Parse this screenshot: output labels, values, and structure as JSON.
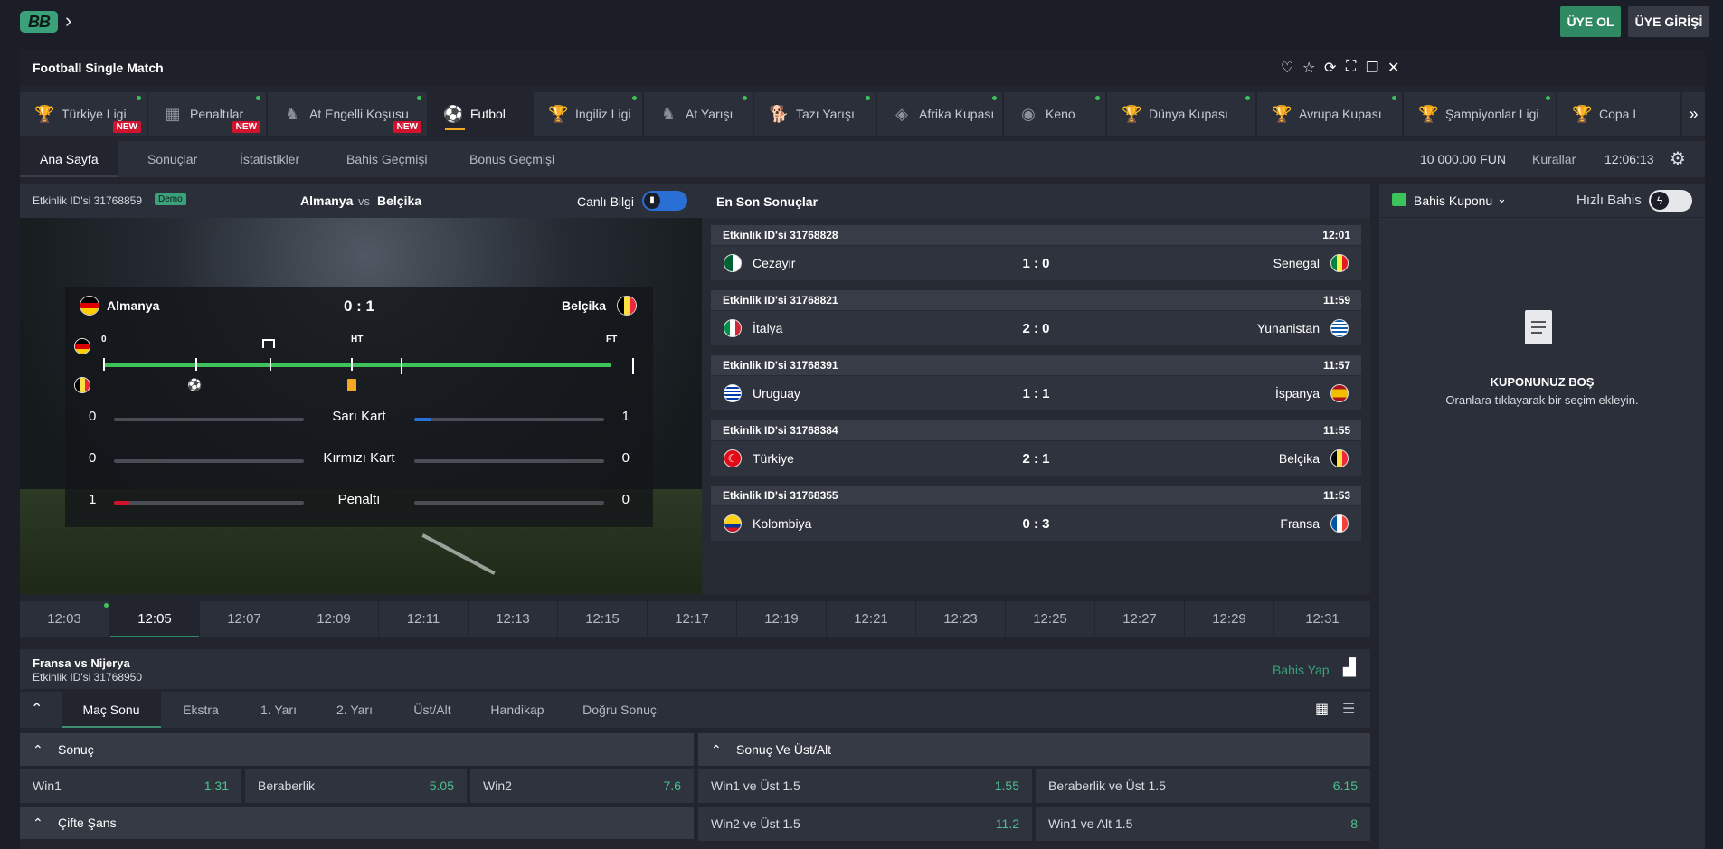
{
  "header": {
    "logo_text": "BB",
    "register": "ÜYE OL",
    "login": "ÜYE GİRİŞİ"
  },
  "window": {
    "title": "Football Single Match"
  },
  "game_tabs": [
    {
      "label": "Türkiye Ligi",
      "badge": "NEW",
      "icon": "trophy-icon"
    },
    {
      "label": "Penaltılar",
      "badge": "NEW",
      "icon": "goal-net-icon"
    },
    {
      "label": "At Engelli Koşusu",
      "badge": "NEW",
      "icon": "horse-jump-icon"
    },
    {
      "label": "Futbol",
      "badge": "",
      "icon": "football-icon"
    },
    {
      "label": "İngiliz Ligi",
      "badge": "",
      "icon": "trophy-icon"
    },
    {
      "label": "At Yarışı",
      "badge": "",
      "icon": "horse-icon"
    },
    {
      "label": "Tazı Yarışı",
      "badge": "",
      "icon": "greyhound-icon"
    },
    {
      "label": "Afrika Kupası",
      "badge": "",
      "icon": "africa-icon"
    },
    {
      "label": "Keno",
      "badge": "",
      "icon": "keno-icon"
    },
    {
      "label": "Dünya Kupası",
      "badge": "",
      "icon": "world-cup-icon"
    },
    {
      "label": "Avrupa Kupası",
      "badge": "",
      "icon": "euro-cup-icon"
    },
    {
      "label": "Şampiyonlar Ligi",
      "badge": "",
      "icon": "champions-cup-icon"
    },
    {
      "label": "Copa L",
      "badge": "",
      "icon": "copa-cup-icon"
    }
  ],
  "sub_nav": {
    "items": [
      "Ana Sayfa",
      "Sonuçlar",
      "İstatistikler",
      "Bahis Geçmişi",
      "Bonus Geçmişi"
    ],
    "balance": "10 000.00 FUN",
    "rules": "Kurallar",
    "clock": "12:06:13"
  },
  "live_match": {
    "event_label": "Etkinlik ID'si 31768859",
    "demo": "Demo",
    "home": "Almanya",
    "vs": "vs",
    "away": "Belçika",
    "live_info": "Canlı Bilgi",
    "score": "0 : 1",
    "timeline": {
      "start": "0",
      "ht": "HT",
      "ft": "FT",
      "progress": 1.0
    },
    "stats": [
      {
        "label": "Sarı Kart",
        "home": "0",
        "away": "1",
        "home_frac": 0.0,
        "away_frac": 0.09
      },
      {
        "label": "Kırmızı Kart",
        "home": "0",
        "away": "0",
        "home_frac": 0.0,
        "away_frac": 0.0
      },
      {
        "label": "Penaltı",
        "home": "1",
        "away": "0",
        "home_frac": 0.08,
        "away_frac": 0.0
      }
    ]
  },
  "latest_results": {
    "title": "En Son Sonuçlar",
    "items": [
      {
        "event": "Etkinlik ID'si 31768828",
        "time": "12:01",
        "home": "Cezayir",
        "score": "1 : 0",
        "away": "Senegal"
      },
      {
        "event": "Etkinlik ID'si 31768821",
        "time": "11:59",
        "home": "İtalya",
        "score": "2 : 0",
        "away": "Yunanistan"
      },
      {
        "event": "Etkinlik ID'si 31768391",
        "time": "11:57",
        "home": "Uruguay",
        "score": "1 : 1",
        "away": "İspanya"
      },
      {
        "event": "Etkinlik ID'si 31768384",
        "time": "11:55",
        "home": "Türkiye",
        "score": "2 : 1",
        "away": "Belçika"
      },
      {
        "event": "Etkinlik ID'si 31768355",
        "time": "11:53",
        "home": "Kolombiya",
        "score": "0 : 3",
        "away": "Fransa"
      }
    ]
  },
  "betslip": {
    "title": "Bahis Kuponu",
    "quick_bet": "Hızlı Bahis",
    "empty_title": "KUPONUNUZ BOŞ",
    "empty_text": "Oranlara tıklayarak bir seçim ekleyin."
  },
  "times": [
    "12:03",
    "12:05",
    "12:07",
    "12:09",
    "12:11",
    "12:13",
    "12:15",
    "12:17",
    "12:19",
    "12:21",
    "12:23",
    "12:25",
    "12:27",
    "12:29",
    "12:31"
  ],
  "next_match": {
    "title": "Fransa vs Nijerya",
    "event": "Etkinlik ID'si 31768950",
    "bet": "Bahis Yap"
  },
  "market_tabs": [
    "Maç Sonu",
    "Ekstra",
    "1. Yarı",
    "2. Yarı",
    "Üst/Alt",
    "Handikap",
    "Doğru Sonuç"
  ],
  "markets": {
    "result": {
      "title": "Sonuç",
      "odds": [
        {
          "label": "Win1",
          "value": "1.31"
        },
        {
          "label": "Beraberlik",
          "value": "5.05"
        },
        {
          "label": "Win2",
          "value": "7.6"
        }
      ]
    },
    "double_chance": {
      "title": "Çifte Şans"
    },
    "result_ou": {
      "title": "Sonuç Ve Üst/Alt",
      "odds": [
        {
          "label": "Win1 ve Üst 1.5",
          "value": "1.55"
        },
        {
          "label": "Beraberlik ve Üst 1.5",
          "value": "6.15"
        },
        {
          "label": "Win2 ve Üst 1.5",
          "value": "11.2"
        },
        {
          "label": "Win1 ve Alt 1.5",
          "value": "8"
        }
      ]
    }
  }
}
